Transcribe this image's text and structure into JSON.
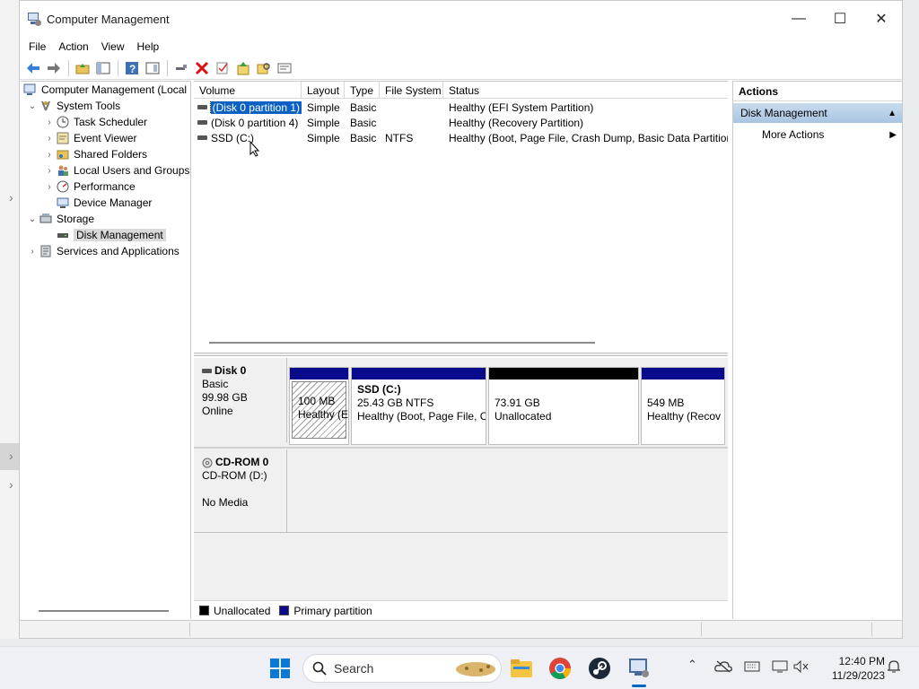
{
  "window": {
    "title": "Computer Management",
    "controls": {
      "minimize": "—",
      "maximize": "☐",
      "close": "✕"
    }
  },
  "menu": [
    "File",
    "Action",
    "View",
    "Help"
  ],
  "toolbar_icons": [
    "back-arrow-icon",
    "forward-arrow-icon",
    "folder-up-icon",
    "show-hide-tree-icon",
    "help-icon",
    "console-view-icon",
    "connect-icon",
    "delete-icon",
    "check-icon",
    "export-icon",
    "search-icon",
    "properties-icon"
  ],
  "tree": {
    "root": "Computer Management (Local",
    "items": [
      {
        "label": "System Tools",
        "icon": "tools-icon"
      },
      {
        "label": "Task Scheduler",
        "icon": "clock-icon"
      },
      {
        "label": "Event Viewer",
        "icon": "event-viewer-icon"
      },
      {
        "label": "Shared Folders",
        "icon": "shared-folder-icon"
      },
      {
        "label": "Local Users and Groups",
        "icon": "users-icon"
      },
      {
        "label": "Performance",
        "icon": "performance-icon"
      },
      {
        "label": "Device Manager",
        "icon": "device-manager-icon"
      },
      {
        "label": "Storage",
        "icon": "storage-icon"
      },
      {
        "label": "Disk Management",
        "icon": "disk-icon"
      },
      {
        "label": "Services and Applications",
        "icon": "services-icon"
      }
    ]
  },
  "volumes": {
    "columns": [
      "Volume",
      "Layout",
      "Type",
      "File System",
      "Status"
    ],
    "rows": [
      {
        "volume": "(Disk 0 partition 1)",
        "layout": "Simple",
        "type": "Basic",
        "fs": "",
        "status": "Healthy (EFI System Partition)"
      },
      {
        "volume": "(Disk 0 partition 4)",
        "layout": "Simple",
        "type": "Basic",
        "fs": "",
        "status": "Healthy (Recovery Partition)"
      },
      {
        "volume": "SSD (C:)",
        "layout": "Simple",
        "type": "Basic",
        "fs": "NTFS",
        "status": "Healthy (Boot, Page File, Crash Dump, Basic Data Partition)"
      }
    ]
  },
  "disks": {
    "disk0": {
      "name": "Disk 0",
      "type": "Basic",
      "size": "99.98 GB",
      "state": "Online"
    },
    "cdrom0": {
      "name": "CD-ROM 0",
      "type": "CD-ROM (D:)",
      "state": "No Media"
    },
    "partitions": [
      {
        "line1": "100 MB",
        "line2": "Healthy (E"
      },
      {
        "title": "SSD  (C:)",
        "line1": "25.43 GB NTFS",
        "line2": "Healthy (Boot, Page File, C"
      },
      {
        "line1": "73.91 GB",
        "line2": "Unallocated"
      },
      {
        "line1": "549 MB",
        "line2": "Healthy (Recov"
      }
    ]
  },
  "legend": {
    "unallocated": "Unallocated",
    "primary": "Primary partition"
  },
  "actions": {
    "title": "Actions",
    "section": "Disk Management",
    "more": "More Actions"
  },
  "taskbar": {
    "search_placeholder": "Search",
    "time": "12:40 PM",
    "date": "11/29/2023"
  },
  "colors": {
    "primary_partition": "#0a0a8c",
    "unallocated": "#000000",
    "selection": "#0b61c3",
    "accent": "#0067c0"
  }
}
